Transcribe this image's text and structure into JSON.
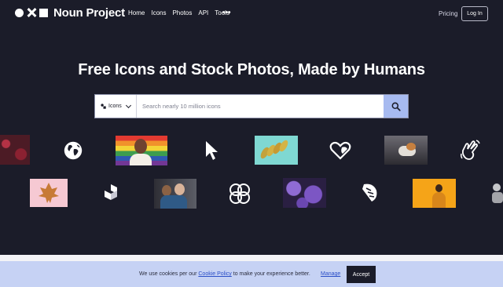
{
  "header": {
    "brand": "Noun Project",
    "nav": [
      "Home",
      "Icons",
      "Photos",
      "API",
      "Tools"
    ],
    "more_label": "•••",
    "pricing": "Pricing",
    "login": "Log In"
  },
  "hero": {
    "title": "Free Icons and Stock Photos, Made by Humans"
  },
  "search": {
    "type_label": "Icons",
    "placeholder": "Search nearly 10 million icons"
  },
  "gallery": {
    "items": [
      {
        "kind": "photo",
        "name": "berries-photo",
        "color": "#8a2531"
      },
      {
        "kind": "icon",
        "name": "globe-icon"
      },
      {
        "kind": "photo",
        "name": "pride-flag-person-photo",
        "color": "#e1542f"
      },
      {
        "kind": "icon",
        "name": "cursor-arrow-icon"
      },
      {
        "kind": "photo",
        "name": "leaves-on-teal-photo",
        "color": "#7fd8d2"
      },
      {
        "kind": "icon",
        "name": "heart-hands-icon"
      },
      {
        "kind": "photo",
        "name": "cat-photo",
        "color": "#4d4b52"
      },
      {
        "kind": "icon",
        "name": "hand-wave-icon"
      },
      {
        "kind": "photo",
        "name": "autumn-leaf-photo",
        "color": "#f6c9d3"
      },
      {
        "kind": "icon",
        "name": "blocks-icon"
      },
      {
        "kind": "photo",
        "name": "family-photo",
        "color": "#4a4b52"
      },
      {
        "kind": "icon",
        "name": "circles-pattern-icon"
      },
      {
        "kind": "photo",
        "name": "purple-flowers-photo",
        "color": "#6c4bb0"
      },
      {
        "kind": "icon",
        "name": "monstera-leaf-icon"
      },
      {
        "kind": "photo",
        "name": "orange-portrait-photo",
        "color": "#f5a418"
      },
      {
        "kind": "icon",
        "name": "partial-figure-icon"
      }
    ]
  },
  "cookie": {
    "text_before": "We use cookies per our",
    "link": "Cookie Policy",
    "text_after": "to make your experience better.",
    "manage": "Manage",
    "accept": "Accept"
  }
}
